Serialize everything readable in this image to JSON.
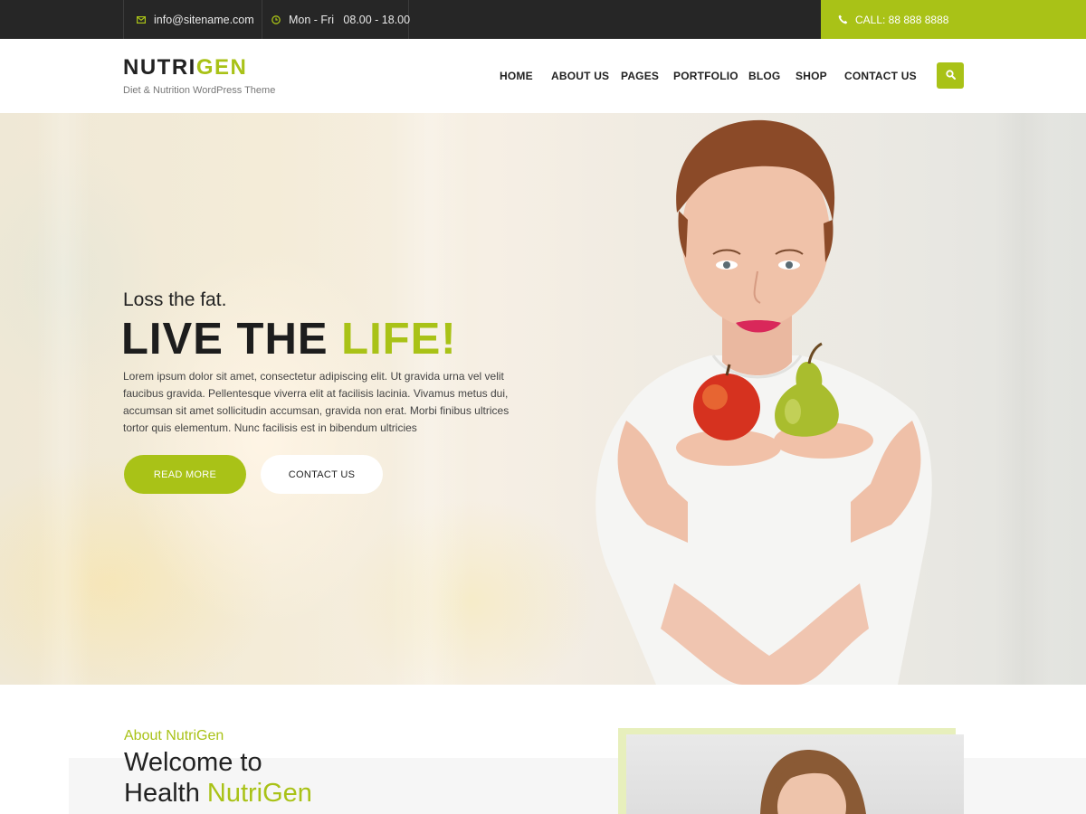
{
  "topbar": {
    "email": "info@sitename.com",
    "hours": "Mon - Fri   08.00 - 18.00",
    "call": "CALL: 88 888 8888",
    "icons": {
      "email": "envelope-icon",
      "hours": "clock-icon",
      "call": "phone-icon"
    }
  },
  "header": {
    "logo_main": "NUTRI",
    "logo_accent": "GEN",
    "tagline": "Diet & Nutrition WordPress Theme",
    "nav": [
      "HOME",
      "ABOUT US",
      "PAGES",
      "PORTFOLIO",
      "BLOG",
      "SHOP",
      "CONTACT US"
    ],
    "search_icon": "search-icon"
  },
  "hero": {
    "subtitle": "Loss the fat.",
    "title_main": "LIVE THE ",
    "title_accent": "LIFE!",
    "text": "Lorem ipsum dolor sit amet, consectetur adipiscing elit. Ut gravida urna vel velit faucibus gravida. Pellentesque viverra elit at facilisis lacinia. Vivamus metus dui, accumsan sit amet sollicitudin accumsan, gravida non erat. Morbi finibus ultrices tortor quis elementum. Nunc facilisis est in bibendum ultricies",
    "read_more": "READ MORE",
    "contact": "CONTACT US"
  },
  "about": {
    "eyebrow": "About NutriGen",
    "title_line1": "Welcome to",
    "title_line2_main": "Health ",
    "title_line2_accent": "NutriGen"
  },
  "colors": {
    "accent": "#a9c217",
    "topbar": "#262626",
    "text": "#222222"
  }
}
